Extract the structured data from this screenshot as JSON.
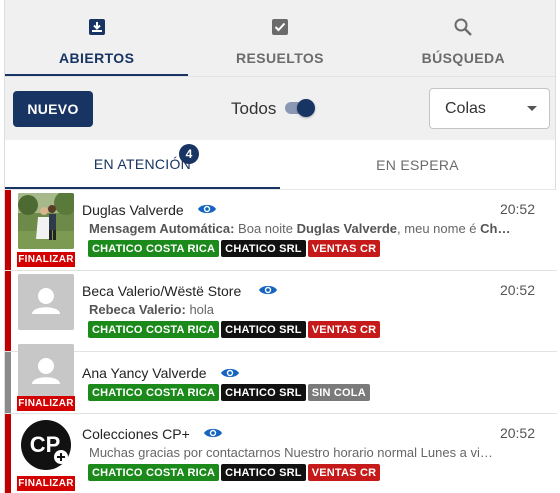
{
  "top_tabs": [
    {
      "label": "ABIERTOS",
      "icon": "inbox-download-icon",
      "active": true
    },
    {
      "label": "RESUELTOS",
      "icon": "checkbox-icon",
      "active": false
    },
    {
      "label": "BÚSQUEDA",
      "icon": "search-icon",
      "active": false
    }
  ],
  "toolbar": {
    "new_label": "NUEVO",
    "todos_label": "Todos",
    "todos_on": true,
    "queue_select_value": "Colas"
  },
  "sub_tabs": [
    {
      "label": "EN ATENCIÓN",
      "active": true,
      "badge": "4"
    },
    {
      "label": "EN ESPERA",
      "active": false
    }
  ],
  "colors": {
    "primary": "#173462",
    "finalizar": "#d40000",
    "tag_green": "#1b8a1b",
    "tag_black": "#111111",
    "tag_red": "#c61a1a",
    "tag_grey": "#7a7a7a"
  },
  "tickets": [
    {
      "name": "Duglas Valverde",
      "time": "20:52",
      "msg_sender": "Mensagem Automática:",
      "msg_text": " Boa noite ",
      "msg_bold2": "Duglas Valverde",
      "msg_text2": ", meu nome é ",
      "msg_bold3": "Ch…",
      "finalizar_label": "FINALIZAR",
      "tags": [
        "CHATICO COSTA RICA",
        "CHATICO SRL",
        "VENTAS CR"
      ],
      "avatar": "photo"
    },
    {
      "name": "Beca Valerio/Wëstë Store",
      "time": "20:52",
      "msg_sender": "Rebeca Valerio:",
      "msg_text": " hola",
      "tags": [
        "CHATICO COSTA RICA",
        "CHATICO SRL",
        "VENTAS CR"
      ],
      "avatar": "placeholder"
    },
    {
      "name": "Ana Yancy Valverde",
      "time": "",
      "finalizar_label": "FINALIZAR",
      "tags": [
        "CHATICO COSTA RICA",
        "CHATICO SRL",
        "SIN COLA"
      ],
      "avatar": "placeholder"
    },
    {
      "name": "Colecciones CP+",
      "time": "20:52",
      "msg_text": "Muchas gracias por contactarnos Nuestro horario normal Lunes a vi…",
      "finalizar_label": "FINALIZAR",
      "tags": [
        "CHATICO COSTA RICA",
        "CHATICO SRL",
        "VENTAS CR"
      ],
      "avatar": "cp-logo"
    }
  ]
}
